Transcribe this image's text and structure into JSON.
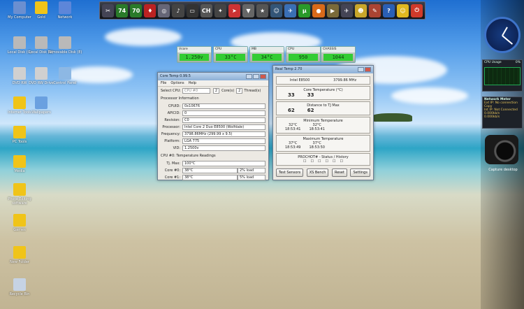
{
  "desktop_icons": [
    {
      "label": "My Computer",
      "color": "#6b8fd0"
    },
    {
      "label": "Gold",
      "color": "#f0c419"
    },
    {
      "label": "Network",
      "color": "#5d86d9"
    },
    {
      "label": "Local Disk (C)",
      "color": "#b9b9b9"
    },
    {
      "label": "Local Disk (D)",
      "color": "#b9b9b9"
    },
    {
      "label": "Removable Disk (E)",
      "color": "#b9b9b9"
    },
    {
      "label": "DVD RW",
      "color": "#d0d0d0"
    },
    {
      "label": "DVD RW Drive",
      "color": "#d0d0d0"
    },
    {
      "label": "Control Panel",
      "color": "#8db8e4"
    },
    {
      "label": "Internet Tools",
      "color": "#f0c419"
    },
    {
      "label": "Wallpapers",
      "color": "#6aa0e0"
    },
    {
      "label": "PC Tools",
      "color": "#f0c419"
    },
    {
      "label": "Media",
      "color": "#f0c419"
    },
    {
      "label": "Photo Editing software",
      "color": "#f0c419"
    },
    {
      "label": "Games",
      "color": "#f0c419"
    },
    {
      "label": "New Folder",
      "color": "#f0c419"
    },
    {
      "label": "Recycle Bin",
      "color": "#c6d3e4"
    }
  ],
  "dock": {
    "items": [
      {
        "name": "tool-icon",
        "glyph": "✂",
        "color": "#445"
      },
      {
        "name": "seventy-four-icon",
        "glyph": "74",
        "color": "#2a7a2a"
      },
      {
        "name": "seventy-icon",
        "glyph": "70",
        "color": "#2a7a2a"
      },
      {
        "name": "flag-icon",
        "glyph": "♦",
        "color": "#b22"
      },
      {
        "name": "disc-icon",
        "glyph": "◎",
        "color": "#667"
      },
      {
        "name": "music-icon",
        "glyph": "♪",
        "color": "#444"
      },
      {
        "name": "gpu-icon",
        "glyph": "▭",
        "color": "#333"
      },
      {
        "name": "ch-icon",
        "glyph": "CH",
        "color": "#555"
      },
      {
        "name": "sword-icon",
        "glyph": "✦",
        "color": "#444"
      },
      {
        "name": "red-app-icon",
        "glyph": "➤",
        "color": "#c33"
      },
      {
        "name": "mail-icon",
        "glyph": "▼",
        "color": "#666"
      },
      {
        "name": "star-icon",
        "glyph": "★",
        "color": "#555"
      },
      {
        "name": "person-icon",
        "glyph": "☺",
        "color": "#357"
      },
      {
        "name": "plane-icon",
        "glyph": "✈",
        "color": "#3a6fb5"
      },
      {
        "name": "torrent-icon",
        "glyph": "µ",
        "color": "#2a9a2a"
      },
      {
        "name": "browser-icon",
        "glyph": "●",
        "color": "#d96a1a"
      },
      {
        "name": "media-icon",
        "glyph": "▶",
        "color": "#7a6a3a"
      },
      {
        "name": "jet-icon",
        "glyph": "✈",
        "color": "#445"
      },
      {
        "name": "smiley-icon",
        "glyph": "☻",
        "color": "#c9a62a"
      },
      {
        "name": "brush-icon",
        "glyph": "✎",
        "color": "#aa4433"
      },
      {
        "name": "help-icon",
        "glyph": "?",
        "color": "#2a5fb5"
      },
      {
        "name": "emoticon-icon",
        "glyph": "☺",
        "color": "#e0b820"
      },
      {
        "name": "power-icon",
        "glyph": "⏻",
        "color": "#d03a2a"
      }
    ]
  },
  "sensors": [
    {
      "title": "Vcore",
      "value": "1.250v"
    },
    {
      "title": "CPU",
      "value": "33°C"
    },
    {
      "title": "MB",
      "value": "34°C"
    },
    {
      "title": "CPU",
      "value": "950"
    },
    {
      "title": "CHASSIS",
      "value": "1044"
    }
  ],
  "core_temp": {
    "title": "Core Temp 0.99.5",
    "menu": [
      "File",
      "Options",
      "Help"
    ],
    "select_cpu_label": "Select CPU:",
    "select_cpu_value": "CPU #0",
    "cores_value": "2",
    "cores_label": "Core(s)",
    "threads_value": "2",
    "threads_label": "Thread(s)",
    "proc_info_label": "Processor Information",
    "fields": [
      {
        "label": "CPUID:",
        "value": "0x10676"
      },
      {
        "label": "APICID:",
        "value": "0"
      },
      {
        "label": "Revision:",
        "value": "C0"
      },
      {
        "label": "Processor:",
        "value": "Intel Core 2 Duo E8500 (Wolfdale)"
      },
      {
        "label": "Frequency:",
        "value": "3798.86MHz (299.99 x 9.5)"
      },
      {
        "label": "Platform:",
        "value": "LGA 775"
      },
      {
        "label": "VID:",
        "value": "1.2500v"
      }
    ],
    "temp_section": "CPU #0: Temperature Readings",
    "tjmax_label": "Tj. Max:",
    "tjmax_value": "100°C",
    "cores": [
      {
        "label": "Core #0:",
        "temp": "38°C",
        "load": "2% load"
      },
      {
        "label": "Core #1:",
        "temp": "38°C",
        "load": "5% load"
      }
    ]
  },
  "real_temp": {
    "title": "Real Temp 2.70",
    "cpu": "Intel E8500",
    "mhz": "3799.86 MHz",
    "core_temp_label": "Core Temperature (°C)",
    "core_temps": [
      "33",
      "33"
    ],
    "tjmax_label": "Distance to TJ Max",
    "tjmax_vals": [
      "62",
      "62"
    ],
    "min_label": "Minimum Temperature",
    "min": [
      {
        "t": "32°C",
        "time": "18:53:41"
      },
      {
        "t": "32°C",
        "time": "18:53:41"
      }
    ],
    "max_label": "Maximum Temperature",
    "max": [
      {
        "t": "37°C",
        "time": "18:53:49"
      },
      {
        "t": "37°C",
        "time": "18:53:50"
      }
    ],
    "prochot_label": "PROCHOT#  -  Status / History",
    "buttons": [
      "Test Sensors",
      "XS Bench",
      "Reset",
      "Settings"
    ]
  },
  "gadgets": {
    "cpu_usage_title": "CPU Usage",
    "cpu_usage_value": "0%",
    "network_title": "Network Meter",
    "network_lines": [
      "Ext IP: No connection Copy",
      "Int IP: Not Connected",
      "0.000kb/s",
      "0.000kb/s"
    ],
    "capture_label": "Capture desktop"
  }
}
